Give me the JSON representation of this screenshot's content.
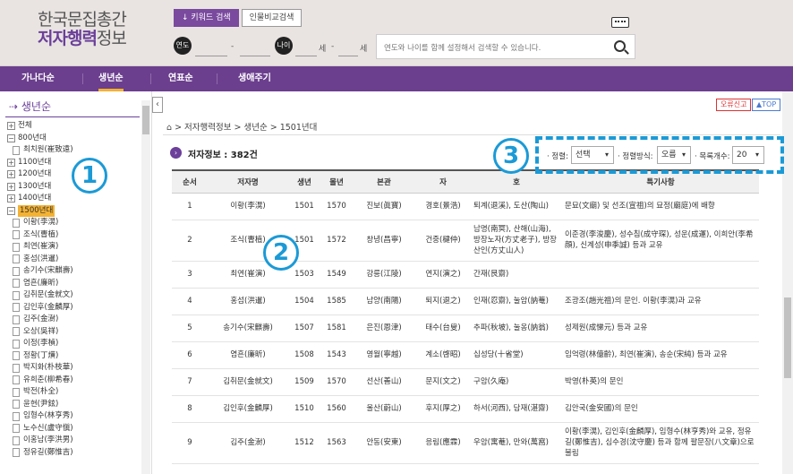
{
  "header": {
    "logo_line1": "한국문집총간",
    "logo_line2_a": "저자행력",
    "logo_line2_b": "정보",
    "tab_keyword": "키워드 검색",
    "tab_compare": "인물비교검색",
    "year_badge": "연도",
    "age_badge": "나이",
    "dash": "-",
    "sep_se": "세",
    "sep_se2": "세",
    "search_placeholder": "연도와 나이를 함께 설정해서 검색할 수 있습니다."
  },
  "nav": {
    "items": [
      "가나다순",
      "생년순",
      "연표순",
      "생애주기"
    ]
  },
  "sidebar": {
    "title": "생년순",
    "tree": [
      {
        "type": "plus",
        "label": "전체"
      },
      {
        "type": "minus",
        "label": "800년대"
      },
      {
        "type": "doc",
        "label": "최치원(崔致遠)"
      },
      {
        "type": "plus",
        "label": "1100년대"
      },
      {
        "type": "plus",
        "label": "1200년대"
      },
      {
        "type": "plus",
        "label": "1300년대"
      },
      {
        "type": "plus",
        "label": "1400년대"
      },
      {
        "type": "minus",
        "label": "1500년대",
        "selected": true
      },
      {
        "type": "doc",
        "label": "이황(李滉)"
      },
      {
        "type": "doc",
        "label": "조식(曺植)"
      },
      {
        "type": "doc",
        "label": "최연(崔演)"
      },
      {
        "type": "doc",
        "label": "홍섬(洪暹)"
      },
      {
        "type": "doc",
        "label": "송기수(宋麒壽)"
      },
      {
        "type": "doc",
        "label": "염흔(廉昕)"
      },
      {
        "type": "doc",
        "label": "김취문(金就文)"
      },
      {
        "type": "doc",
        "label": "김인후(金麟厚)"
      },
      {
        "type": "doc",
        "label": "김주(金澍)"
      },
      {
        "type": "doc",
        "label": "오상(吳祥)"
      },
      {
        "type": "doc",
        "label": "이정(李楨)"
      },
      {
        "type": "doc",
        "label": "정황(丁熿)"
      },
      {
        "type": "doc",
        "label": "박지화(朴枝華)"
      },
      {
        "type": "doc",
        "label": "유희춘(柳希春)"
      },
      {
        "type": "doc",
        "label": "박전(朴全)"
      },
      {
        "type": "doc",
        "label": "윤현(尹鉉)"
      },
      {
        "type": "doc",
        "label": "임형수(林亨秀)"
      },
      {
        "type": "doc",
        "label": "노수신(盧守愼)"
      },
      {
        "type": "doc",
        "label": "이홍남(李洪男)"
      },
      {
        "type": "doc",
        "label": "정유길(鄭惟吉)"
      }
    ]
  },
  "content": {
    "err_btn": "오류신고",
    "top_btn": "TOP",
    "breadcrumb": "> 저자행력정보 > 생년순 > 1501년대",
    "info": "저자정보 : 382건",
    "sort_label": "· 정렬:",
    "sort_value": "선택",
    "order_label": "· 정렬방식:",
    "order_value": "오름",
    "count_label": "· 목록개수:",
    "count_value": "20",
    "columns": [
      "순서",
      "저자명",
      "생년",
      "몰년",
      "본관",
      "자",
      "호",
      "특기사항"
    ],
    "rows": [
      [
        "1",
        "이황(李滉)",
        "1501",
        "1570",
        "진보(眞寶)",
        "경호(景浩)",
        "퇴계(退溪), 도산(陶山)",
        "문묘(文廟) 및 선조(宣祖)의 묘정(廟庭)에 배향"
      ],
      [
        "2",
        "조식(曺植)",
        "1501",
        "1572",
        "창녕(昌寧)",
        "건중(楗仲)",
        "남명(南冥), 산해(山海), 방장노자(方丈老子), 방장산인(方丈山人)",
        "이준경(李浚慶), 성수침(成守琛), 성운(成運), 이희안(李希顔), 신계성(申季誠) 등과 교유"
      ],
      [
        "3",
        "최연(崔演)",
        "1503",
        "1549",
        "강릉(江陵)",
        "연지(演之)",
        "간재(艮齋)",
        ""
      ],
      [
        "4",
        "홍섬(洪暹)",
        "1504",
        "1585",
        "남양(南陽)",
        "퇴지(退之)",
        "인재(忍齋), 눌암(訥菴)",
        "조광조(趙光祖)의 문인. 이황(李滉)과 교유"
      ],
      [
        "5",
        "송기수(宋麒壽)",
        "1507",
        "1581",
        "은진(恩津)",
        "태수(台叟)",
        "추파(秋坡), 눌옹(訥翁)",
        "성제원(成悌元) 등과 교유"
      ],
      [
        "6",
        "염흔(廉昕)",
        "1508",
        "1543",
        "영월(寧越)",
        "계소(啓昭)",
        "십성당(十省堂)",
        "임억령(林億齡), 최연(崔演), 송순(宋純) 등과 교유"
      ],
      [
        "7",
        "김취문(金就文)",
        "1509",
        "1570",
        "선산(善山)",
        "문지(文之)",
        "구암(久庵)",
        "박영(朴英)의 문인"
      ],
      [
        "8",
        "김인후(金麟厚)",
        "1510",
        "1560",
        "울산(蔚山)",
        "후지(厚之)",
        "하서(河西), 담재(湛齋)",
        "김안국(金安國)의 문인"
      ],
      [
        "9",
        "김주(金澍)",
        "1512",
        "1563",
        "안동(安東)",
        "응림(應霖)",
        "우암(寓菴), 만와(萬窩)",
        "이황(李滉), 김인후(金麟厚), 임형수(林亨秀)와 교유, 정유길(鄭惟吉), 심수경(沈守慶) 등과 함께 팔문장(八文章)으로 불림"
      ]
    ]
  },
  "annotations": {
    "a1": "1",
    "a2": "2",
    "a3": "3"
  }
}
